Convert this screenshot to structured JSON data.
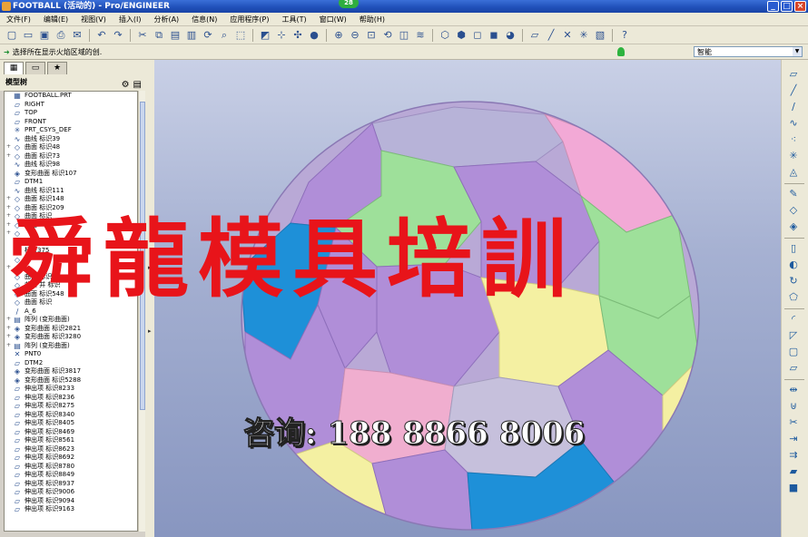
{
  "window": {
    "title": "FOOTBALL (活动的) - Pro/ENGINEER",
    "badge": "28",
    "minimize": "_",
    "restore": "□",
    "close": "×"
  },
  "menu": [
    "文件(F)",
    "编辑(E)",
    "视图(V)",
    "插入(I)",
    "分析(A)",
    "信息(N)",
    "应用程序(P)",
    "工具(T)",
    "窗口(W)",
    "帮助(H)"
  ],
  "toolbar_icons": [
    "new-icon",
    "open-icon",
    "save-icon",
    "print-icon",
    "email-icon",
    "sep",
    "undo-icon",
    "redo-icon",
    "sep",
    "cut-icon",
    "copy-icon",
    "paste-icon",
    "paste-special-icon",
    "regenerate-icon",
    "find-icon",
    "select-box-icon",
    "sep",
    "repaint-icon",
    "orient-icon",
    "spin-center-icon",
    "shading-icon",
    "sep",
    "zoom-in-icon",
    "zoom-out-icon",
    "refit-icon",
    "reorient-icon",
    "saved-views-icon",
    "layers-icon",
    "sep",
    "wireframe-icon",
    "hidden-line-icon",
    "no-hidden-icon",
    "shaded-icon",
    "appearance-icon",
    "sep",
    "datum-planes-icon",
    "datum-axes-icon",
    "datum-points-icon",
    "csys-icon",
    "annotation-icon",
    "sep",
    "context-help-icon"
  ],
  "prompt": {
    "message": "选择所在显示火焰区域的创.",
    "filter_value": "智能"
  },
  "navigator": {
    "tabs": [
      "tree-tab-icon",
      "folder-tab-icon",
      "favorites-tab-icon"
    ],
    "header": "模型树"
  },
  "tree": [
    {
      "label": "FOOTBALL.PRT",
      "icon": "▦",
      "exp": ""
    },
    {
      "label": "RIGHT",
      "icon": "⏥",
      "exp": ""
    },
    {
      "label": "TOP",
      "icon": "⏥",
      "exp": ""
    },
    {
      "label": "FRONT",
      "icon": "⏥",
      "exp": ""
    },
    {
      "label": "PRT_CSYS_DEF",
      "icon": "✳",
      "exp": ""
    },
    {
      "label": "曲线 标识39",
      "icon": "∿",
      "exp": ""
    },
    {
      "label": "曲面 标识48",
      "icon": "◇",
      "exp": "+"
    },
    {
      "label": "曲面 标识73",
      "icon": "◇",
      "exp": "+"
    },
    {
      "label": "曲线 标识98",
      "icon": "∿",
      "exp": ""
    },
    {
      "label": "变形曲面 标识107",
      "icon": "◈",
      "exp": ""
    },
    {
      "label": "DTM1",
      "icon": "⏥",
      "exp": ""
    },
    {
      "label": "曲线 标识111",
      "icon": "∿",
      "exp": ""
    },
    {
      "label": "曲面 标识148",
      "icon": "◇",
      "exp": "+"
    },
    {
      "label": "曲面 标识209",
      "icon": "◇",
      "exp": "+"
    },
    {
      "label": "曲面 标识",
      "icon": "◇",
      "exp": "+"
    },
    {
      "label": "曲面",
      "icon": "◇",
      "exp": "+"
    },
    {
      "label": "",
      "icon": "◇",
      "exp": "+"
    },
    {
      "label": "",
      "icon": "◇",
      "exp": ""
    },
    {
      "label": "标识375",
      "icon": "◇",
      "exp": ""
    },
    {
      "label": "",
      "icon": "◇",
      "exp": ""
    },
    {
      "label": "",
      "icon": "◇",
      "exp": "+"
    },
    {
      "label": "曲面 标识",
      "icon": "◇",
      "exp": ""
    },
    {
      "label": "曲面 并 标识",
      "icon": "◇",
      "exp": ""
    },
    {
      "label": "曲面 标识548",
      "icon": "◇",
      "exp": ""
    },
    {
      "label": "曲面 标识",
      "icon": "◇",
      "exp": ""
    },
    {
      "label": "A_6",
      "icon": "∕",
      "exp": ""
    },
    {
      "label": "阵列 (变形曲面)",
      "icon": "▤",
      "exp": "+"
    },
    {
      "label": "变形曲面 标识2821",
      "icon": "◈",
      "exp": "+"
    },
    {
      "label": "变形曲面 标识3280",
      "icon": "◈",
      "exp": "+"
    },
    {
      "label": "阵列 (变形曲面)",
      "icon": "▤",
      "exp": "+"
    },
    {
      "label": "PNT0",
      "icon": "✕",
      "exp": ""
    },
    {
      "label": "DTM2",
      "icon": "⏥",
      "exp": ""
    },
    {
      "label": "变形曲面 标识3817",
      "icon": "◈",
      "exp": ""
    },
    {
      "label": "变形曲面 标识5288",
      "icon": "◈",
      "exp": ""
    },
    {
      "label": "伸出项 标识8233",
      "icon": "▱",
      "exp": ""
    },
    {
      "label": "伸出项 标识8236",
      "icon": "▱",
      "exp": ""
    },
    {
      "label": "伸出项 标识8275",
      "icon": "▱",
      "exp": ""
    },
    {
      "label": "伸出项 标识8340",
      "icon": "▱",
      "exp": ""
    },
    {
      "label": "伸出项 标识8405",
      "icon": "▱",
      "exp": ""
    },
    {
      "label": "伸出项 标识8469",
      "icon": "▱",
      "exp": ""
    },
    {
      "label": "伸出项 标识8561",
      "icon": "▱",
      "exp": ""
    },
    {
      "label": "伸出项 标识8623",
      "icon": "▱",
      "exp": ""
    },
    {
      "label": "伸出项 标识8692",
      "icon": "▱",
      "exp": ""
    },
    {
      "label": "伸出项 标识8780",
      "icon": "▱",
      "exp": ""
    },
    {
      "label": "伸出项 标识8849",
      "icon": "▱",
      "exp": ""
    },
    {
      "label": "伸出项 标识8937",
      "icon": "▱",
      "exp": ""
    },
    {
      "label": "伸出项 标识9006",
      "icon": "▱",
      "exp": ""
    },
    {
      "label": "伸出项 标识9094",
      "icon": "▱",
      "exp": ""
    },
    {
      "label": "伸出项 标识9163",
      "icon": "▱",
      "exp": ""
    }
  ],
  "overlay": {
    "title": "舜龍模具培訓",
    "contact": "咨询: 188 8866 8006"
  },
  "colors": {
    "overlay_red": "#e8141a",
    "viewport_top": "#c9d0e6",
    "viewport_bottom": "#8896c0"
  },
  "right_toolbar": [
    "datum-plane-icon",
    "datum-axis-icon",
    "sketch-curve-icon",
    "curve-icon",
    "datum-point-icon",
    "csys-icon",
    "analysis-icon",
    "sep",
    "sketch-icon",
    "boundary-blend-icon",
    "style-icon",
    "sep",
    "extrude-icon",
    "revolve-icon",
    "sweep-icon",
    "blend-icon",
    "sep",
    "round-icon",
    "draft-icon",
    "shell-icon",
    "rib-icon",
    "sep",
    "mirror-icon",
    "merge-icon",
    "trim-icon",
    "extend-icon",
    "offset-icon",
    "thicken-icon",
    "solidify-icon"
  ]
}
